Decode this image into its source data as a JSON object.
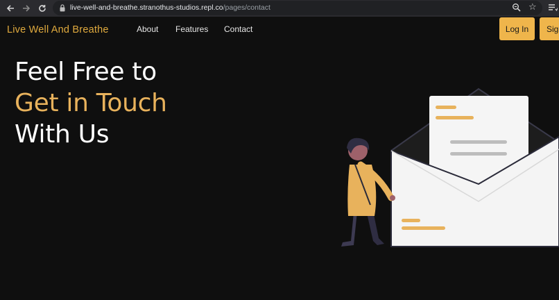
{
  "browser": {
    "url_host": "live-well-and-breathe.stranothus-studios.repl.co",
    "url_path": "/pages/contact",
    "back_icon": "arrow-left-icon",
    "forward_icon": "arrow-right-icon",
    "reload_icon": "reload-icon",
    "zoom_icon": "magnifier-icon",
    "bookmark_icon": "star-icon",
    "menu_icon": "list-menu-icon"
  },
  "header": {
    "brand": "Live Well And Breathe",
    "nav": [
      {
        "label": "About"
      },
      {
        "label": "Features"
      },
      {
        "label": "Contact"
      }
    ],
    "login_label": "Log In",
    "signup_label": "Sign Up"
  },
  "hero": {
    "line1": "Feel Free to",
    "line2": "Get in Touch",
    "line3": "With Us"
  },
  "colors": {
    "background": "#0f0f0f",
    "accent": "#efb54b",
    "brand_text": "#e0aa3e",
    "hero_accent": "#e8b25c"
  }
}
